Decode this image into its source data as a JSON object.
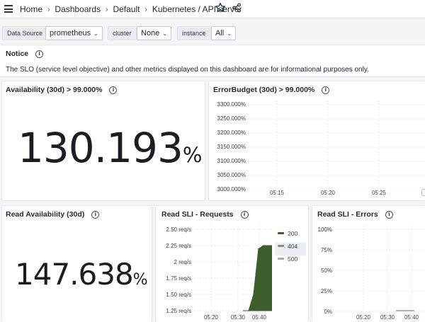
{
  "breadcrumb": {
    "home": "Home",
    "dashboards": "Dashboards",
    "folder": "Default",
    "dashboard": "Kubernetes / API server"
  },
  "filters": {
    "datasource": {
      "label": "Data Source",
      "value": "prometheus"
    },
    "cluster": {
      "label": "cluster",
      "value": "None"
    },
    "instance": {
      "label": "instance",
      "value": "All"
    }
  },
  "notice": {
    "title": "Notice",
    "text": "The SLO (service level objective) and other metrics displayed on this dashboard are for informational purposes only."
  },
  "availability": {
    "title": "Availability (30d) > 99.000%",
    "value": "130.193",
    "unit": "%"
  },
  "error_budget": {
    "title": "ErrorBudget (30d) > 99.000%",
    "yticks": [
      "3300.000%",
      "3250.000%",
      "3200.000%",
      "3150.000%",
      "3100.000%",
      "3050.000%",
      "3000.000%"
    ],
    "xticks": [
      "05:15",
      "05:20",
      "05:25"
    ]
  },
  "read_availability": {
    "title": "Read Availability (30d)",
    "value": "147.638",
    "unit": "%"
  },
  "read_requests": {
    "title": "Read SLI - Requests",
    "yticks": [
      "2.50 req/s",
      "2.25 req/s",
      "2 req/s",
      "1.75 req/s",
      "1.50 req/s",
      "1.25 req/s"
    ],
    "xticks": [
      "05:20",
      "05:30",
      "05:40"
    ],
    "legend": [
      {
        "name": "200",
        "color": "#3b5e2b"
      },
      {
        "name": "404",
        "color": "#8a8a8a"
      },
      {
        "name": "500",
        "color": "#a7a7a7"
      }
    ]
  },
  "read_errors": {
    "title": "Read SLI - Errors",
    "yticks": [
      "100%",
      "75%",
      "50%",
      "25%",
      "0%"
    ],
    "xticks": [
      "05:20",
      "05:30",
      "05:40"
    ]
  },
  "chart_data": [
    {
      "type": "area",
      "title": "Read SLI - Requests",
      "x": [
        "05:35",
        "05:36",
        "05:37",
        "05:38",
        "05:39",
        "05:40",
        "05:41"
      ],
      "series": [
        {
          "name": "200",
          "values": [
            1.25,
            1.25,
            1.5,
            2.2,
            2.25,
            2.25,
            2.25
          ]
        }
      ],
      "ylim": [
        1.25,
        2.5
      ],
      "legend": "right"
    }
  ]
}
